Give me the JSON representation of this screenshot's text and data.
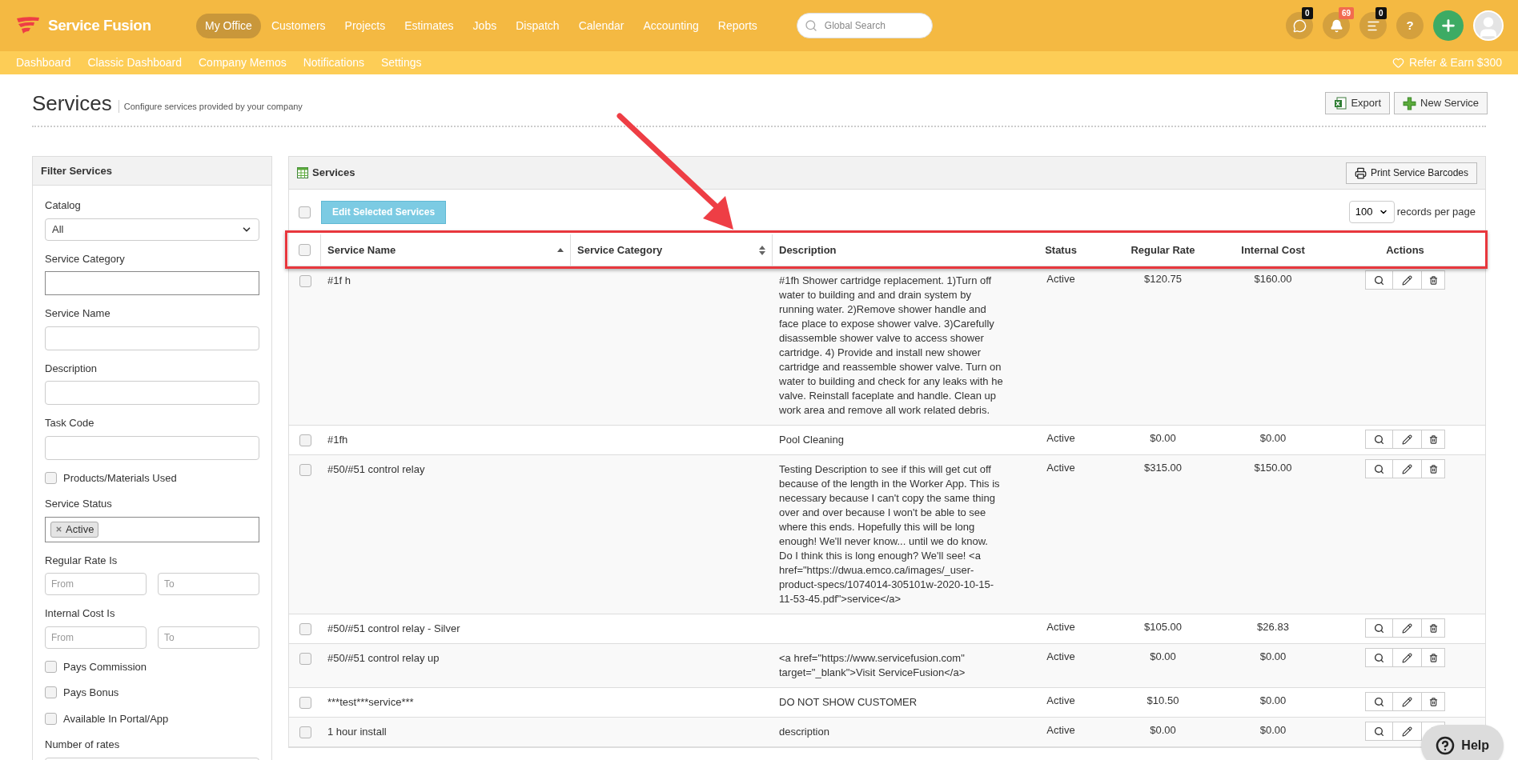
{
  "top_nav": {
    "brand": "Service Fusion",
    "items": [
      {
        "label": "My Office",
        "selected": true
      },
      {
        "label": "Customers",
        "selected": false
      },
      {
        "label": "Projects",
        "selected": false
      },
      {
        "label": "Estimates",
        "selected": false
      },
      {
        "label": "Jobs",
        "selected": false
      },
      {
        "label": "Dispatch",
        "selected": false
      },
      {
        "label": "Calendar",
        "selected": false
      },
      {
        "label": "Accounting",
        "selected": false
      },
      {
        "label": "Reports",
        "selected": false
      }
    ],
    "search": {
      "placeholder": "Global Search"
    },
    "icons": [
      {
        "kind": "chat",
        "badge": "0",
        "color": "#111111"
      },
      {
        "kind": "bell",
        "badge": "69",
        "color": "#f26b4f"
      },
      {
        "kind": "list",
        "badge": "0",
        "color": "#111111"
      },
      {
        "kind": "help",
        "label": "?"
      },
      {
        "kind": "add"
      },
      {
        "kind": "avatar"
      }
    ]
  },
  "sub_nav": {
    "items": [
      "Dashboard",
      "Classic Dashboard",
      "Company Memos",
      "Notifications",
      "Settings"
    ],
    "refer": "Refer & Earn $300"
  },
  "page": {
    "title": "Services",
    "subtitle": "Configure services provided by your company",
    "buttons": [
      {
        "kind": "export",
        "label": "Export"
      },
      {
        "kind": "new",
        "label": "New Service"
      }
    ]
  },
  "filter": {
    "title": "Filter Services",
    "fields": [
      {
        "kind": "select",
        "label": "Catalog",
        "value": "All"
      },
      {
        "kind": "text",
        "label": "Service Category",
        "focused": true
      },
      {
        "kind": "text",
        "label": "Service Name",
        "focused": false
      },
      {
        "kind": "text",
        "label": "Description",
        "focused": false
      },
      {
        "kind": "text",
        "label": "Task Code",
        "focused": false
      },
      {
        "kind": "checkbox",
        "label": "Products/Materials Used",
        "checked": false
      },
      {
        "kind": "tags",
        "label": "Service Status",
        "tags": [
          "Active"
        ]
      },
      {
        "kind": "range",
        "label": "Regular Rate Is",
        "placeholders": [
          "From",
          "To"
        ]
      },
      {
        "kind": "range",
        "label": "Internal Cost Is",
        "placeholders": [
          "From",
          "To"
        ]
      },
      {
        "kind": "checkbox",
        "label": "Pays Commission",
        "checked": false
      },
      {
        "kind": "checkbox",
        "label": "Pays Bonus",
        "checked": false
      },
      {
        "kind": "checkbox",
        "label": "Available In Portal/App",
        "checked": false
      },
      {
        "kind": "text",
        "label": "Number of rates",
        "focused": false
      }
    ]
  },
  "services": {
    "title": "Services",
    "print_button": "Print Service Barcodes",
    "edit_button": "Edit Selected Services",
    "select_all_checked": false,
    "per_page": {
      "value": "100",
      "label": "records per page"
    },
    "header_checked": false,
    "columns": [
      {
        "label": "Service Name",
        "sortable": true,
        "sorted": true
      },
      {
        "label": "Service Category",
        "sortable": true,
        "sorted": false
      },
      {
        "label": "Description"
      },
      {
        "label": "Status"
      },
      {
        "label": "Regular Rate"
      },
      {
        "label": "Internal Cost"
      },
      {
        "label": "Actions"
      }
    ],
    "rows": [
      {
        "checked": false,
        "name": "#1f h",
        "description": "#1fh Shower cartridge replacement. 1)Turn off water to building and and drain system by running water. 2)Remove shower handle and face place to expose shower valve. 3)Carefully disassemble shower valve to access shower cartridge. 4) Provide and install new shower cartridge and reassemble shower valve. Turn on water to building and check for any leaks with he valve. Reinstall faceplate and handle. Clean up work area and remove all work related debris.",
        "status": "Active",
        "rate": "$120.75",
        "cost": "$160.00"
      },
      {
        "checked": false,
        "name": "#1fh",
        "description": "Pool Cleaning",
        "status": "Active",
        "rate": "$0.00",
        "cost": "$0.00"
      },
      {
        "checked": false,
        "name": "#50/#51 control relay",
        "description": "Testing Description to see if this will get cut off because of the length in the Worker App. This is necessary because I can't copy the same thing over and over because I won't be able to see where this ends. Hopefully this will be long enough! We'll never know... until we do know. Do I think this is long enough? We'll see! <a href=\"https://dwua.emco.ca/images/_user-product-specs/1074014-305101w-2020-10-15-11-53-45.pdf\">service</a>",
        "status": "Active",
        "rate": "$315.00",
        "cost": "$150.00"
      },
      {
        "checked": false,
        "name": "#50/#51 control relay - Silver",
        "status": "Active",
        "rate": "$105.00",
        "cost": "$26.83"
      },
      {
        "checked": false,
        "name": "#50/#51 control relay up",
        "description": "<a href=\"https://www.servicefusion.com\" target=\"_blank\">Visit ServiceFusion</a>",
        "status": "Active",
        "rate": "$0.00",
        "cost": "$0.00"
      },
      {
        "checked": false,
        "name": "***test***service***",
        "description": "DO NOT SHOW CUSTOMER",
        "status": "Active",
        "rate": "$10.50",
        "cost": "$0.00"
      },
      {
        "checked": false,
        "name": "1 hour install",
        "description": "description",
        "status": "Active",
        "rate": "$0.00",
        "cost": "$0.00"
      }
    ]
  },
  "help_button": "Help"
}
